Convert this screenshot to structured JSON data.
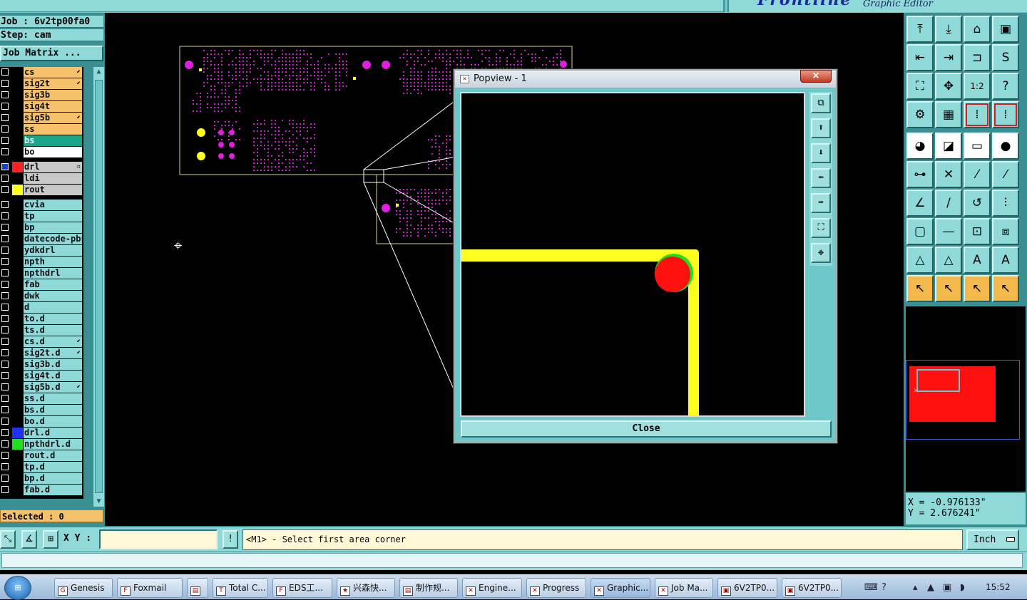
{
  "app": {
    "brand_logo": "Frontline",
    "brand_subtitle": "Graphic Editor",
    "job_line": "Job : 6v2tp00fa0",
    "step_line": "Step: cam",
    "job_matrix_label": "Job Matrix ...",
    "selected_text": "Selected : 0"
  },
  "layers": [
    {
      "name": "cs",
      "color": "#f5c26b",
      "swatch": "#000",
      "mark": "⬋"
    },
    {
      "name": "sig2t",
      "color": "#f5c26b",
      "swatch": "#000",
      "mark": "⬋"
    },
    {
      "name": "sig3b",
      "color": "#f5c26b",
      "swatch": "#000",
      "mark": ""
    },
    {
      "name": "sig4t",
      "color": "#f5c26b",
      "swatch": "#000",
      "mark": ""
    },
    {
      "name": "sig5b",
      "color": "#f5c26b",
      "swatch": "#000",
      "mark": "⬋"
    },
    {
      "name": "ss",
      "color": "#f5c26b",
      "swatch": "#000",
      "mark": ""
    },
    {
      "name": "bs",
      "color": "#1aa58a",
      "swatch": "#000",
      "mark": ""
    },
    {
      "name": "bo",
      "color": "#ffffff",
      "swatch": "#000",
      "mark": ""
    },
    {
      "name": "drl",
      "color": "#c8c8c8",
      "swatch": "#ff2020",
      "mark": "▫",
      "checked": true
    },
    {
      "name": "ldi",
      "color": "#c8c8c8",
      "swatch": "#000",
      "mark": ""
    },
    {
      "name": "rout",
      "color": "#c8c8c8",
      "swatch": "#ffff20",
      "mark": ""
    },
    {
      "name": "cvia",
      "color": "#8fd9d8",
      "swatch": "#000",
      "mark": ""
    },
    {
      "name": "tp",
      "color": "#8fd9d8",
      "swatch": "#000",
      "mark": ""
    },
    {
      "name": "bp",
      "color": "#8fd9d8",
      "swatch": "#000",
      "mark": ""
    },
    {
      "name": "datecode-pbs",
      "color": "#8fd9d8",
      "swatch": "#000",
      "mark": ""
    },
    {
      "name": "ydkdrl",
      "color": "#8fd9d8",
      "swatch": "#000",
      "mark": ""
    },
    {
      "name": "npth",
      "color": "#8fd9d8",
      "swatch": "#000",
      "mark": ""
    },
    {
      "name": "npthdrl",
      "color": "#8fd9d8",
      "swatch": "#000",
      "mark": ""
    },
    {
      "name": "fab",
      "color": "#8fd9d8",
      "swatch": "#000",
      "mark": ""
    },
    {
      "name": "dwk",
      "color": "#8fd9d8",
      "swatch": "#000",
      "mark": ""
    },
    {
      "name": "d",
      "color": "#8fd9d8",
      "swatch": "#000",
      "mark": ""
    },
    {
      "name": "to.d",
      "color": "#8fd9d8",
      "swatch": "#000",
      "mark": ""
    },
    {
      "name": "ts.d",
      "color": "#8fd9d8",
      "swatch": "#000",
      "mark": ""
    },
    {
      "name": "cs.d",
      "color": "#8fd9d8",
      "swatch": "#000",
      "mark": "⬋"
    },
    {
      "name": "sig2t.d",
      "color": "#8fd9d8",
      "swatch": "#000",
      "mark": "⬋"
    },
    {
      "name": "sig3b.d",
      "color": "#8fd9d8",
      "swatch": "#000",
      "mark": ""
    },
    {
      "name": "sig4t.d",
      "color": "#8fd9d8",
      "swatch": "#000",
      "mark": ""
    },
    {
      "name": "sig5b.d",
      "color": "#8fd9d8",
      "swatch": "#000",
      "mark": "⬋"
    },
    {
      "name": "ss.d",
      "color": "#8fd9d8",
      "swatch": "#000",
      "mark": ""
    },
    {
      "name": "bs.d",
      "color": "#8fd9d8",
      "swatch": "#000",
      "mark": ""
    },
    {
      "name": "bo.d",
      "color": "#8fd9d8",
      "swatch": "#000",
      "mark": ""
    },
    {
      "name": "drl.d",
      "color": "#8fd9d8",
      "swatch": "#2030ff",
      "mark": ""
    },
    {
      "name": "npthdrl.d",
      "color": "#8fd9d8",
      "swatch": "#20e020",
      "mark": ""
    },
    {
      "name": "rout.d",
      "color": "#8fd9d8",
      "swatch": "#000",
      "mark": ""
    },
    {
      "name": "tp.d",
      "color": "#8fd9d8",
      "swatch": "#000",
      "mark": ""
    },
    {
      "name": "bp.d",
      "color": "#8fd9d8",
      "swatch": "#000",
      "mark": ""
    },
    {
      "name": "fab.d",
      "color": "#8fd9d8",
      "swatch": "#000",
      "mark": ""
    }
  ],
  "popview": {
    "title": "Popview - 1",
    "close_x": "×",
    "close_label": "Close",
    "tools": [
      "⧉",
      "⬆",
      "⬇",
      "⬅",
      "➡",
      "⛶",
      "✥"
    ]
  },
  "toolbar": {
    "rows": [
      [
        {
          "g": "⤒",
          "s": "t",
          "n": "zoom-home-icon"
        },
        {
          "g": "⤓",
          "s": "t",
          "n": "zoom-down-icon"
        },
        {
          "g": "⌂",
          "s": "t",
          "n": "home-view-icon"
        },
        {
          "g": "▣",
          "s": "t",
          "n": "fit-view-icon"
        }
      ],
      [
        {
          "g": "⇤",
          "s": "t",
          "n": "pan-left-icon"
        },
        {
          "g": "⇥",
          "s": "t",
          "n": "pan-right-icon"
        },
        {
          "g": "⊐",
          "s": "t",
          "n": "pan-box-icon"
        },
        {
          "g": "S",
          "s": "t",
          "n": "snap-icon"
        }
      ],
      [
        {
          "g": "⛶",
          "s": "t",
          "n": "zoom-fit-icon"
        },
        {
          "g": "✥",
          "s": "t",
          "n": "zoom-center-icon"
        },
        {
          "g": "1:2",
          "s": "t",
          "n": "scale-icon"
        },
        {
          "g": "?",
          "s": "t",
          "n": "help-icon"
        }
      ],
      [
        {
          "g": "⚙",
          "s": "t",
          "n": "settings-icon"
        },
        {
          "g": "▦",
          "s": "t",
          "n": "grid-icon"
        },
        {
          "g": "⁞",
          "s": "r",
          "n": "measure-icon"
        },
        {
          "g": "⁞",
          "s": "r",
          "n": "measure-alt-icon"
        }
      ],
      [
        {
          "g": "◕",
          "s": "w",
          "n": "pad-icon"
        },
        {
          "g": "◪",
          "s": "w",
          "n": "fill-icon"
        },
        {
          "g": "▭",
          "s": "w",
          "n": "ruler-icon"
        },
        {
          "g": "●",
          "s": "w",
          "n": "dot-icon"
        }
      ],
      [
        {
          "g": "⊶",
          "s": "t",
          "n": "connect-icon"
        },
        {
          "g": "✕",
          "s": "t",
          "n": "cross-icon"
        },
        {
          "g": "⁄",
          "s": "t",
          "n": "line-icon"
        },
        {
          "g": "⁄",
          "s": "t",
          "n": "line-alt-icon"
        }
      ],
      [
        {
          "g": "∠",
          "s": "t",
          "n": "angle-icon"
        },
        {
          "g": "/",
          "s": "t",
          "n": "slash-icon"
        },
        {
          "g": "↺",
          "s": "t",
          "n": "rotate-icon"
        },
        {
          "g": "⫶",
          "s": "t",
          "n": "split-icon"
        }
      ],
      [
        {
          "g": "▢",
          "s": "t",
          "n": "box-icon"
        },
        {
          "g": "—",
          "s": "t",
          "n": "dash-icon"
        },
        {
          "g": "⊡",
          "s": "t",
          "n": "frame-icon"
        },
        {
          "g": "⧈",
          "s": "t",
          "n": "group-icon"
        }
      ],
      [
        {
          "g": "△",
          "s": "t",
          "n": "triangle-icon"
        },
        {
          "g": "△",
          "s": "t",
          "n": "triangle-alt-icon"
        },
        {
          "g": "A",
          "s": "t",
          "n": "arc-icon"
        },
        {
          "g": "A",
          "s": "t",
          "n": "arc-alt-icon"
        }
      ],
      [
        {
          "g": "↖",
          "s": "y",
          "n": "select-icon"
        },
        {
          "g": "↖",
          "s": "y",
          "n": "select-box-icon"
        },
        {
          "g": "↖",
          "s": "y",
          "n": "select-area-icon"
        },
        {
          "g": "↖",
          "s": "y",
          "n": "select-net-icon"
        }
      ]
    ]
  },
  "coords": {
    "x": "X = -0.976133\"",
    "y": "Y = 2.676241\""
  },
  "bottom": {
    "xy_label": "X Y :",
    "xy_value": "",
    "message": "<M1> - Select first area corner",
    "unit": "Inch"
  },
  "taskbar": {
    "start_label": "Start",
    "tasks": [
      {
        "label": "Genesis",
        "icon": "G"
      },
      {
        "label": "Foxmail",
        "icon": "F"
      },
      {
        "label": "",
        "icon": "▤"
      },
      {
        "label": "Total C...",
        "icon": "T"
      },
      {
        "label": "EDS工...",
        "icon": "F"
      },
      {
        "label": "兴森快...",
        "icon": "★"
      },
      {
        "label": "制作规...",
        "icon": "▤"
      },
      {
        "label": "Engine...",
        "icon": "✕"
      },
      {
        "label": "Progress",
        "icon": "✕"
      },
      {
        "label": "Graphic...",
        "icon": "✕",
        "active": true
      },
      {
        "label": "Job Ma...",
        "icon": "✕"
      },
      {
        "label": "6V2TP0...",
        "icon": "▣"
      },
      {
        "label": "6V2TP0...",
        "icon": "▣"
      }
    ],
    "clock": "15:52"
  }
}
